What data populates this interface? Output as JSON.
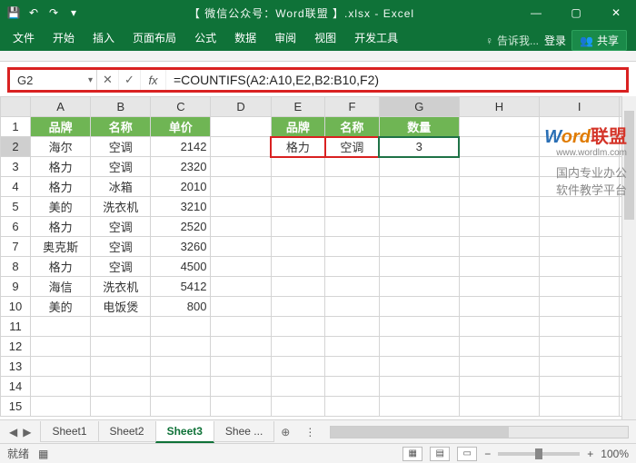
{
  "window": {
    "title": "【 微信公众号：Word联盟 】.xlsx - Excel",
    "qa": {
      "save": "💾",
      "undo": "↶",
      "redo": "↷",
      "dd": "▾"
    },
    "min": "—",
    "max": "▢",
    "close": "✕"
  },
  "tabs": {
    "items": [
      "文件",
      "开始",
      "插入",
      "页面布局",
      "公式",
      "数据",
      "审阅",
      "视图",
      "开发工具"
    ],
    "tellme_icon": "♀",
    "tellme": "告诉我...",
    "login": "登录",
    "share_icon": "👥",
    "share": "共享"
  },
  "formula_bar": {
    "namebox": "G2",
    "cancel": "✕",
    "enter": "✓",
    "fx": "fx",
    "formula": "=COUNTIFS(A2:A10,E2,B2:B10,F2)",
    "expand": "˅"
  },
  "grid": {
    "cols": [
      "A",
      "B",
      "C",
      "D",
      "E",
      "F",
      "G",
      "H",
      "I"
    ],
    "header_row": {
      "A": "品牌",
      "B": "名称",
      "C": "单价",
      "E": "品牌",
      "F": "名称",
      "G": "数量"
    },
    "data": [
      {
        "r": 2,
        "A": "海尔",
        "B": "空调",
        "C": "2142",
        "E": "格力",
        "F": "空调",
        "G": "3"
      },
      {
        "r": 3,
        "A": "格力",
        "B": "空调",
        "C": "2320"
      },
      {
        "r": 4,
        "A": "格力",
        "B": "冰箱",
        "C": "2010"
      },
      {
        "r": 5,
        "A": "美的",
        "B": "洗衣机",
        "C": "3210"
      },
      {
        "r": 6,
        "A": "格力",
        "B": "空调",
        "C": "2520"
      },
      {
        "r": 7,
        "A": "奥克斯",
        "B": "空调",
        "C": "3260"
      },
      {
        "r": 8,
        "A": "格力",
        "B": "空调",
        "C": "4500"
      },
      {
        "r": 9,
        "A": "海信",
        "B": "洗衣机",
        "C": "5412"
      },
      {
        "r": 10,
        "A": "美的",
        "B": "电饭煲",
        "C": "800"
      }
    ],
    "empty_rows": [
      11,
      12,
      13,
      14,
      15
    ]
  },
  "watermark": {
    "w": "W",
    "ord": "ord",
    "cn": "联盟",
    "url": "www.wordlm.com",
    "line1": "国内专业办公",
    "line2": "软件教学平台"
  },
  "sheets": {
    "nav_prev": "◀",
    "nav_next": "▶",
    "items": [
      "Sheet1",
      "Sheet2",
      "Sheet3",
      "Shee ..."
    ],
    "active": 2,
    "add": "⊕",
    "more": "⋮"
  },
  "status": {
    "ready": "就绪",
    "rec": "▦",
    "views": [
      "▦",
      "▤",
      "▭"
    ],
    "minus": "−",
    "plus": "+",
    "zoom": "100%"
  }
}
